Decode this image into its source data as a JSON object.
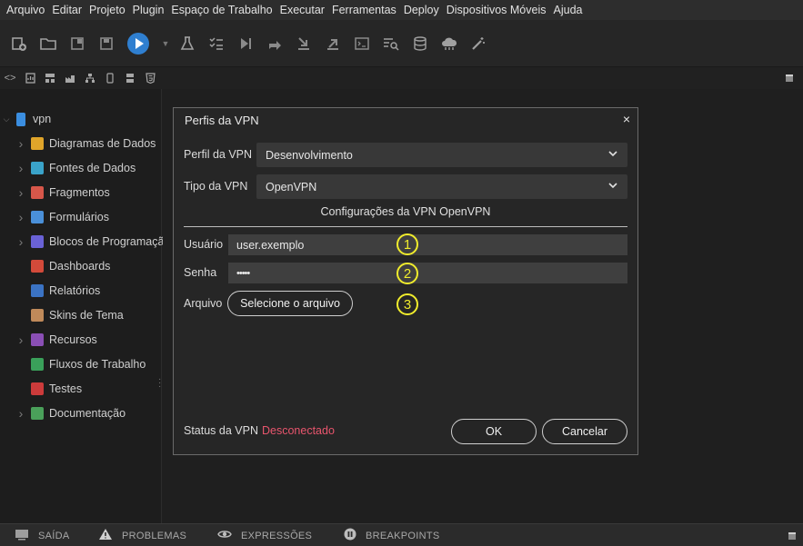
{
  "menu": [
    "Arquivo",
    "Editar",
    "Projeto",
    "Plugin",
    "Espaço de Trabalho",
    "Executar",
    "Ferramentas",
    "Deploy",
    "Dispositivos Móveis",
    "Ajuda"
  ],
  "sidebar": {
    "project": "vpn",
    "items": [
      {
        "label": "Diagramas de Dados",
        "icon": "diagram-icon",
        "color": "#e0a52a",
        "chevron": true
      },
      {
        "label": "Fontes de Dados",
        "icon": "datasource-icon",
        "color": "#3aa3c9",
        "chevron": true
      },
      {
        "label": "Fragmentos",
        "icon": "fragment-icon",
        "color": "#d7574a",
        "chevron": true
      },
      {
        "label": "Formulários",
        "icon": "form-icon",
        "color": "#4a90d9",
        "chevron": true
      },
      {
        "label": "Blocos de Programação",
        "icon": "blocks-icon",
        "color": "#6a62d6",
        "chevron": true
      },
      {
        "label": "Dashboards",
        "icon": "dashboard-icon",
        "color": "#d34a3a",
        "chevron": false
      },
      {
        "label": "Relatórios",
        "icon": "report-icon",
        "color": "#3b73c4",
        "chevron": false
      },
      {
        "label": "Skins de Tema",
        "icon": "palette-icon",
        "color": "#c08a5a",
        "chevron": false
      },
      {
        "label": "Recursos",
        "icon": "resources-icon",
        "color": "#8a4fb5",
        "chevron": true
      },
      {
        "label": "Fluxos de Trabalho",
        "icon": "workflow-icon",
        "color": "#3aa05a",
        "chevron": false
      },
      {
        "label": "Testes",
        "icon": "tests-icon",
        "color": "#cc3b3b",
        "chevron": false
      },
      {
        "label": "Documentação",
        "icon": "docs-icon",
        "color": "#4aa05a",
        "chevron": true
      }
    ]
  },
  "dialog": {
    "title": "Perfis da VPN",
    "close": "×",
    "profile_label": "Perfil da VPN",
    "profile_value": "Desenvolvimento",
    "type_label": "Tipo da VPN",
    "type_value": "OpenVPN",
    "section_title": "Configurações da VPN OpenVPN",
    "user_label": "Usuário",
    "user_value": "user.exemplo",
    "password_label": "Senha",
    "password_value": "•••••",
    "file_label": "Arquivo",
    "file_button": "Selecione o arquivo",
    "status_label": "Status da VPN",
    "status_value": "Desconectado",
    "status_color": "#e8556d",
    "ok": "OK",
    "cancel": "Cancelar",
    "markers": [
      "1",
      "2",
      "3"
    ],
    "marker_color": "#f0ec2c"
  },
  "bottom_tabs": [
    {
      "label": "SAÍDA",
      "icon": "monitor-icon"
    },
    {
      "label": "PROBLEMAS",
      "icon": "warning-icon"
    },
    {
      "label": "EXPRESSÕES",
      "icon": "eye-icon"
    },
    {
      "label": "BREAKPOINTS",
      "icon": "pause-icon"
    }
  ],
  "accent": "#2f7fd0"
}
